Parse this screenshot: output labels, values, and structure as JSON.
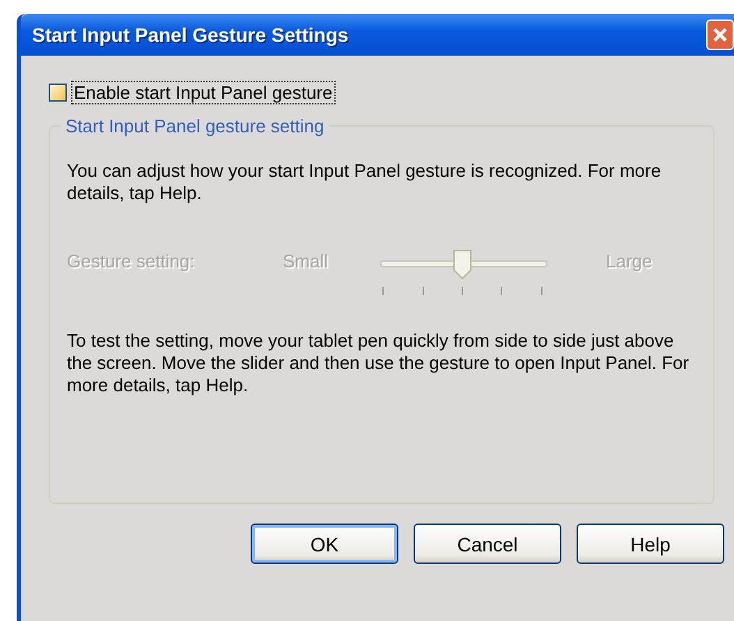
{
  "window": {
    "title": "Start Input Panel Gesture Settings"
  },
  "enable_checkbox": {
    "label": "Enable start Input Panel gesture",
    "checked": false
  },
  "group": {
    "title": "Start Input Panel gesture setting",
    "disabled": true,
    "intro": "You can adjust how your start Input Panel gesture is recognized. For more details, tap Help.",
    "slider": {
      "label": "Gesture setting:",
      "min_label": "Small",
      "max_label": "Large",
      "level": 0.5
    },
    "instructions": "To test the setting, move your tablet pen quickly from side to side just above the screen. Move the slider and then use the gesture to open Input Panel. For more details, tap Help."
  },
  "buttons": [
    {
      "label": "OK",
      "default": true
    },
    {
      "label": "Cancel",
      "default": false
    },
    {
      "label": "Help",
      "default": false
    }
  ]
}
